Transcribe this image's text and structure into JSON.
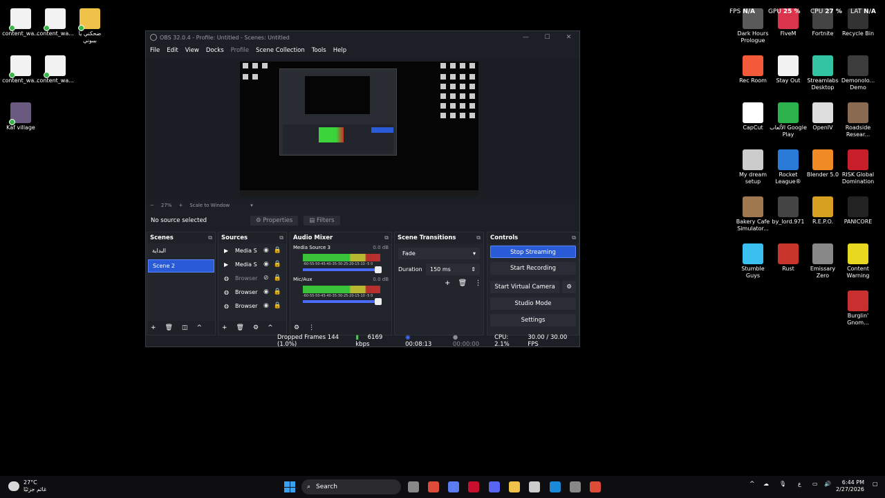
{
  "desktop": {
    "left_icons": [
      {
        "label": "content_wa...",
        "color": "#f2f2f2"
      },
      {
        "label": "content_wa...",
        "color": "#f2f2f2"
      },
      {
        "label": "ضحكني يا بيبوني",
        "color": "#f0c24a"
      },
      {
        "label": "content_wa...",
        "color": "#f2f2f2"
      },
      {
        "label": "content_wa...",
        "color": "#f2f2f2"
      },
      {
        "label": "Kaf village",
        "color": "#6a5a80"
      }
    ],
    "right_icons": [
      {
        "label": "Dark Hours Prologue",
        "color": "#5a5a5a"
      },
      {
        "label": "FiveM",
        "color": "#d9344b"
      },
      {
        "label": "Fortnite",
        "color": "#444"
      },
      {
        "label": "Recycle Bin",
        "color": "#333"
      },
      {
        "label": "Rec Room",
        "color": "#f25a3a"
      },
      {
        "label": "Stay Out",
        "color": "#f2f2f2"
      },
      {
        "label": "Streamlabs Desktop",
        "color": "#31c3a2"
      },
      {
        "label": "Demonolo... Demo",
        "color": "#3c3c3c"
      },
      {
        "label": "CapCut",
        "color": "#fff"
      },
      {
        "label": "الألعاب Google Play",
        "color": "#2bb24c"
      },
      {
        "label": "OpenIV",
        "color": "#ddd"
      },
      {
        "label": "Roadside Resear...",
        "color": "#8a6a50"
      },
      {
        "label": "My dream setup",
        "color": "#ccc"
      },
      {
        "label": "Rocket League®",
        "color": "#2a7ad8"
      },
      {
        "label": "Blender 5.0",
        "color": "#f08a24"
      },
      {
        "label": "RISK Global Domination",
        "color": "#c81e2a"
      },
      {
        "label": "Bakery Cafe Simulator...",
        "color": "#a07850"
      },
      {
        "label": "by_lord.971",
        "color": "#444"
      },
      {
        "label": "R.E.P.O.",
        "color": "#d8a020"
      },
      {
        "label": "PANICORE",
        "color": "#222"
      },
      {
        "label": "Stumble Guys",
        "color": "#3ac0f0"
      },
      {
        "label": "Rust",
        "color": "#c8352a"
      },
      {
        "label": "Emissary Zero",
        "color": "#888"
      },
      {
        "label": "Content Warning",
        "color": "#e8d820"
      },
      {
        "label": "Burglin' Gnom...",
        "color": "#c83030"
      }
    ],
    "hud": {
      "fps": "FPS",
      "fps_val": "N/A",
      "gpu": "GPU",
      "gpu_val": "25 %",
      "cpu": "CPU",
      "cpu_val": "27 %",
      "lat": "LAT",
      "lat_val": "N/A"
    }
  },
  "obs": {
    "title": "OBS 32.0.4 - Profile: Untitled - Scenes: Untitled",
    "menu": [
      "File",
      "Edit",
      "View",
      "Docks",
      "Profile",
      "Scene Collection",
      "Tools",
      "Help"
    ],
    "zoom": "27%",
    "scale": "Scale to Window",
    "no_source": "No source selected",
    "properties": "Properties",
    "filters": "Filters",
    "scenes_title": "Scenes",
    "scenes": [
      "البداية",
      "Scene 2"
    ],
    "sources_title": "Sources",
    "sources": [
      "Media S",
      "Media S",
      "Browser",
      "Browser",
      "Browser"
    ],
    "mixer_title": "Audio Mixer",
    "mixer": [
      {
        "name": "Media Source 3",
        "db": "0.0 dB"
      },
      {
        "name": "Mic/Aux",
        "db": "0.0 dB"
      }
    ],
    "meter_ticks": "-60-55-50-45-40-35-30-25-20-15-10 -5 0",
    "transitions_title": "Scene Transitions",
    "transition": "Fade",
    "duration_label": "Duration",
    "duration": "150 ms",
    "controls_title": "Controls",
    "controls": [
      "Stop Streaming",
      "Start Recording",
      "Start Virtual Camera",
      "Studio Mode",
      "Settings"
    ],
    "status": {
      "dropped": "Dropped Frames 144 (1.0%)",
      "kbps": "6169 kbps",
      "live": "00:08:13",
      "rec": "00:00:00",
      "cpu": "CPU: 2.1%",
      "fps": "30.00 / 30.00 FPS"
    }
  },
  "taskbar": {
    "temp": "27°C",
    "weather": "غائم جزئيًا",
    "search": "Search",
    "time": "6:44 PM",
    "date": "2/27/2026",
    "lang": "ع"
  }
}
